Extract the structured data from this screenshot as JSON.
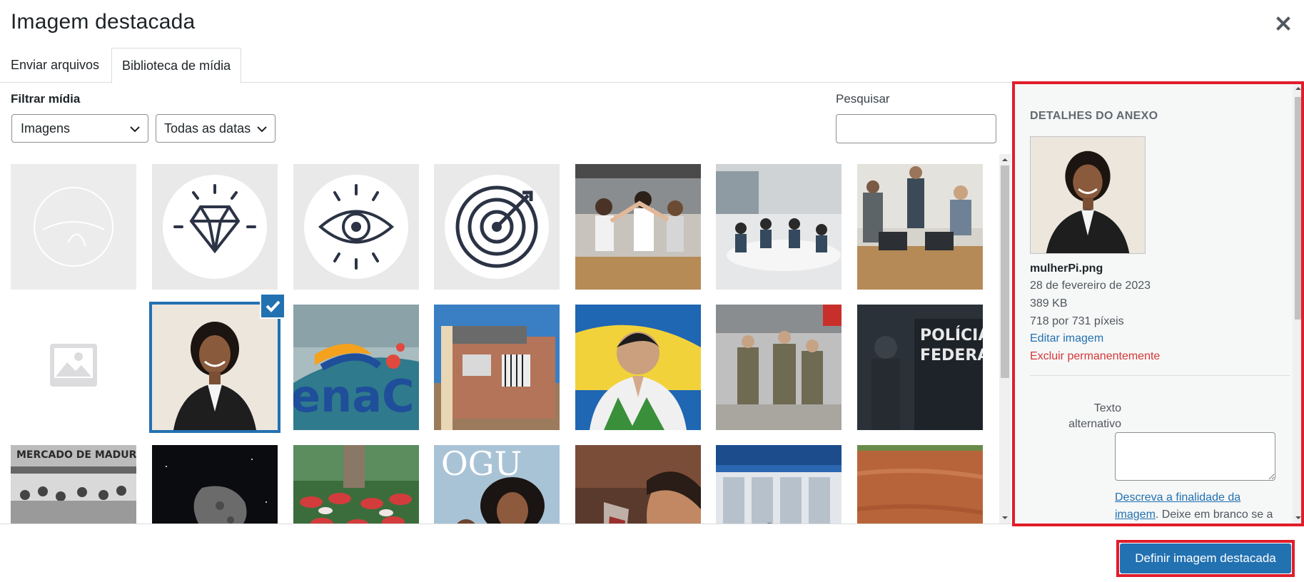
{
  "modal": {
    "title": "Imagem destacada",
    "close_icon": "close-icon"
  },
  "tabs": [
    {
      "label": "Enviar arquivos",
      "active": false
    },
    {
      "label": "Biblioteca de mídia",
      "active": true
    }
  ],
  "filter": {
    "label": "Filtrar mídia",
    "type_value": "Imagens",
    "date_value": "Todas as datas"
  },
  "search": {
    "label": "Pesquisar",
    "value": ""
  },
  "grid": {
    "selected_index": 8,
    "items": [
      "logo-watermark",
      "diamond-icon",
      "eye-icon",
      "target-icon",
      "team-celebration",
      "meeting-room",
      "office-presentation",
      "placeholder-image",
      "woman-portrait",
      "senac-logo",
      "brick-house",
      "boy-praying",
      "soldiers",
      "federal-police",
      "mercado-madureira",
      "asteroid",
      "crowd-umbrellas",
      "magazine-cover",
      "man-drinking",
      "bank-queue",
      "muddy-river"
    ]
  },
  "details": {
    "heading": "Detalhes do anexo",
    "filename": "mulherPi.png",
    "date": "28 de fevereiro de 2023",
    "size": "389 KB",
    "dimensions": "718 por 731 píxeis",
    "edit_link": "Editar imagem",
    "delete_link": "Excluir permanentemente",
    "alt_label": "Texto alternativo",
    "alt_value": "",
    "alt_help_link": "Descreva a finalidade da imagem",
    "alt_help_rest": ". Deixe em branco se a"
  },
  "footer": {
    "primary_button": "Definir imagem destacada"
  },
  "colors": {
    "accent": "#2271b1",
    "danger": "#d63638",
    "highlight": "#e11d2a"
  }
}
